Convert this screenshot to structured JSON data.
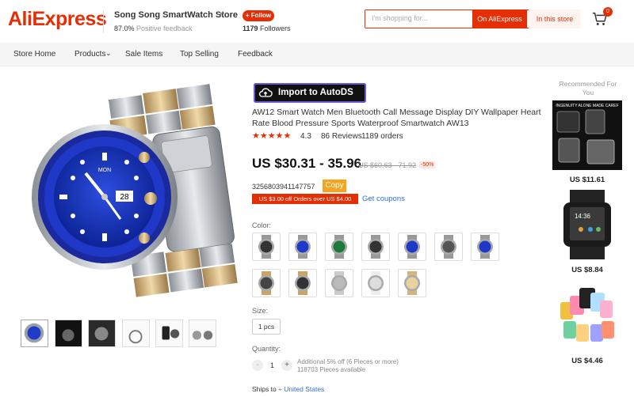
{
  "header": {
    "logo": "AliExpress",
    "store_name": "Song Song SmartWatch Store",
    "positive_pct": "87.0%",
    "positive_label": "Positive feedback",
    "follow_label": "+ Follow",
    "followers_count": "1179",
    "followers_label": "Followers",
    "search_placeholder": "I'm shopping for...",
    "search_ae_label": "On AliExpress",
    "search_store_label": "In this store",
    "cart_count": "0"
  },
  "nav": {
    "items": [
      "Store Home",
      "Products",
      "Sale Items",
      "Top Selling",
      "Feedback"
    ]
  },
  "product": {
    "autods_label": "Import to AutoDS",
    "title": "AW12 Smart Watch Men Bluetooth Call Message Display DIY Wallpaper Heart Rate Blood Pressure Sports Waterproof Smartwatch AW13",
    "stars": "★★★★★",
    "rating": 4.3,
    "rating_text": "4.3",
    "reviews": "86 Reviews",
    "orders": "1189 orders",
    "price": "US $30.31 - 35.96",
    "old_price": "US $60.63 - 71.92",
    "discount": "-50%",
    "sku": "3256803941147757",
    "copy_label": "Copy",
    "coupon": "US $3.00 off Orders over US $4.00",
    "get_coupons": "Get coupons",
    "color_label": "Color:",
    "size_label": "Size:",
    "size_value": "1 pcs",
    "quantity_label": "Quantity:",
    "quantity_value": "1",
    "quantity_minus": "-",
    "quantity_plus": "+",
    "quantity_note_1": "Additional 5% off (6 Pieces or more)",
    "quantity_note_2": "118703 Pieces available",
    "ships_label": "Ships to",
    "ships_to": "United States"
  },
  "recommended": {
    "title": "Recommended For You",
    "items": [
      {
        "price": "US $11.61",
        "banner": "INGENUITY ALONE MADE CAREF"
      },
      {
        "price": "US $8.84",
        "screen": "14:36"
      },
      {
        "price": "US $4.46"
      }
    ]
  },
  "icons": {
    "cart": "cart-icon",
    "autods": "cloud-upload-icon",
    "location": "location-pin-icon"
  },
  "colors": {
    "brand": "#e62e04",
    "link": "#2e6fd6",
    "copy": "#f8a31e"
  }
}
